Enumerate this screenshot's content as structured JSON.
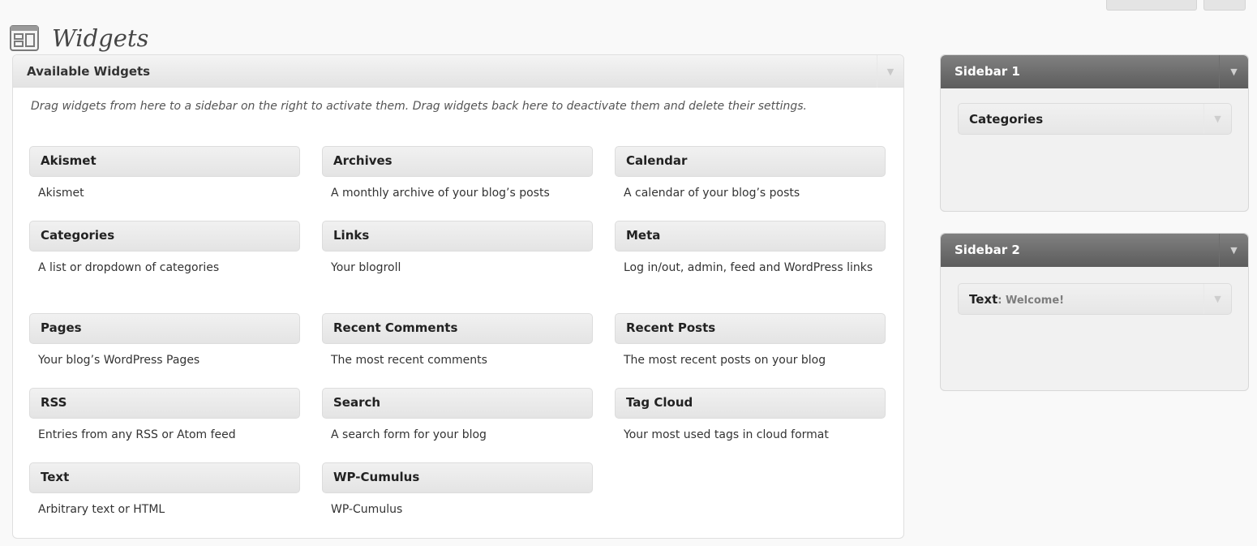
{
  "header": {
    "title": "Widgets",
    "icon": "widgets-icon"
  },
  "available": {
    "title": "Available Widgets",
    "description": "Drag widgets from here to a sidebar on the right to activate them. Drag widgets back here to deactivate them and delete their settings.",
    "toggle": "▼",
    "widgets": [
      {
        "title": "Akismet",
        "description": "Akismet"
      },
      {
        "title": "Archives",
        "description": "A monthly archive of your blog’s posts"
      },
      {
        "title": "Calendar",
        "description": "A calendar of your blog’s posts"
      },
      {
        "title": "Categories",
        "description": "A list or dropdown of categories"
      },
      {
        "title": "Links",
        "description": "Your blogroll"
      },
      {
        "title": "Meta",
        "description": "Log in/out, admin, feed and WordPress links"
      },
      {
        "title": "Pages",
        "description": "Your blog’s WordPress Pages"
      },
      {
        "title": "Recent Comments",
        "description": "The most recent comments"
      },
      {
        "title": "Recent Posts",
        "description": "The most recent posts on your blog"
      },
      {
        "title": "RSS",
        "description": "Entries from any RSS or Atom feed"
      },
      {
        "title": "Search",
        "description": "A search form for your blog"
      },
      {
        "title": "Tag Cloud",
        "description": "Your most used tags in cloud format"
      },
      {
        "title": "Text",
        "description": "Arbitrary text or HTML"
      },
      {
        "title": "WP-Cumulus",
        "description": "WP-Cumulus"
      }
    ]
  },
  "sidebars": [
    {
      "title": "Sidebar 1",
      "toggle": "▼",
      "widget": {
        "title": "Categories",
        "subtitle": "",
        "toggle": "▼"
      }
    },
    {
      "title": "Sidebar 2",
      "toggle": "▼",
      "widget": {
        "title": "Text",
        "subtitle": ": Welcome!",
        "toggle": "▼"
      }
    }
  ]
}
